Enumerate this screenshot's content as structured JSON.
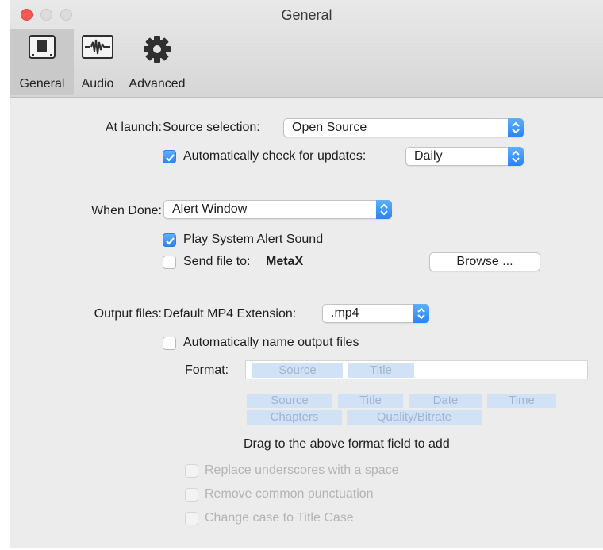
{
  "window": {
    "title": "General"
  },
  "toolbar": {
    "items": [
      {
        "label": "General",
        "icon": "general-panel-icon"
      },
      {
        "label": "Audio",
        "icon": "audio-waveform-icon"
      },
      {
        "label": "Advanced",
        "icon": "gear-icon"
      }
    ]
  },
  "at_launch": {
    "label": "At launch:",
    "source_label": "Source selection:",
    "source_value": "Open Source",
    "update_label": "Automatically check for updates:",
    "update_checked": true,
    "update_value": "Daily"
  },
  "when_done": {
    "label": "When Done:",
    "value": "Alert Window",
    "play_sound_label": "Play System Alert Sound",
    "play_sound_checked": true,
    "send_file_label": "Send file to:",
    "send_file_target": "MetaX",
    "send_file_checked": false,
    "browse_label": "Browse ..."
  },
  "output_files": {
    "label": "Output files:",
    "ext_label": "Default MP4 Extension:",
    "ext_value": ".mp4",
    "auto_name_label": "Automatically name output files",
    "auto_name_checked": false,
    "format_label": "Format:",
    "format_tokens": [
      "Source",
      "Title"
    ],
    "available_tokens": [
      "Source",
      "Title",
      "Date",
      "Time",
      "Chapters",
      "Quality/Bitrate"
    ],
    "drag_hint": "Drag to the above format field to add",
    "options": [
      {
        "label": "Replace underscores with a space",
        "checked": false,
        "enabled": false
      },
      {
        "label": "Remove common punctuation",
        "checked": false,
        "enabled": false
      },
      {
        "label": "Change case to Title Case",
        "checked": false,
        "enabled": false
      }
    ]
  },
  "colors": {
    "accent": "#2a82f6",
    "close": "#fc5753",
    "token_bg": "#d2e2f6"
  }
}
